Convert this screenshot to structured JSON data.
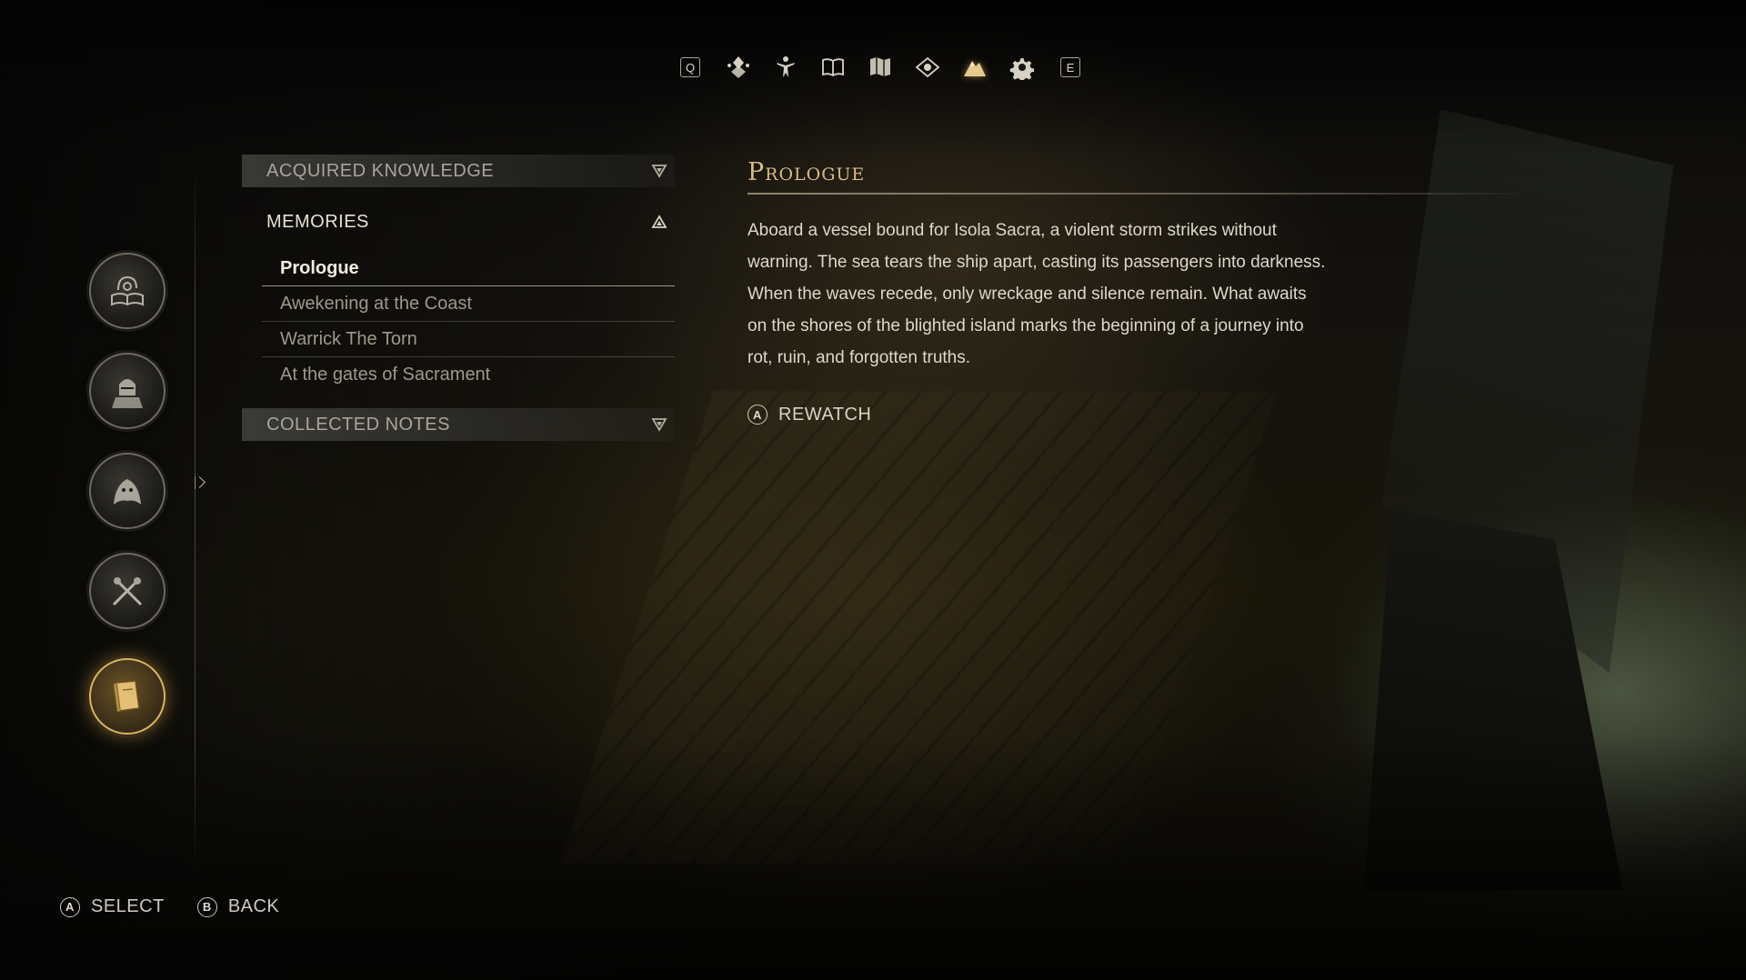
{
  "top_nav": {
    "left_key": "Q",
    "right_key": "E",
    "icons": [
      {
        "name": "emblem-icon",
        "active": false
      },
      {
        "name": "character-icon",
        "active": false
      },
      {
        "name": "journal-book-icon",
        "active": false
      },
      {
        "name": "map-icon",
        "active": false
      },
      {
        "name": "eye-icon",
        "active": false
      },
      {
        "name": "mountain-knowledge-icon",
        "active": true
      },
      {
        "name": "gear-icon",
        "active": false
      }
    ]
  },
  "side_rail": {
    "medallions": [
      {
        "name": "lore-book-medallion",
        "active": false
      },
      {
        "name": "knight-medallion",
        "active": false
      },
      {
        "name": "beasts-medallion",
        "active": false
      },
      {
        "name": "weapons-medallion",
        "active": false
      },
      {
        "name": "tome-medallion",
        "active": true
      }
    ]
  },
  "knowledge": {
    "acquired_label": "ACQUIRED KNOWLEDGE",
    "memories_label": "MEMORIES",
    "collected_label": "COLLECTED NOTES",
    "memories": [
      {
        "label": "Prologue"
      },
      {
        "label": "Awekening at the Coast"
      },
      {
        "label": "Warrick The Torn"
      },
      {
        "label": "At the gates of Sacrament"
      }
    ]
  },
  "detail": {
    "title": "Prologue",
    "body": "Aboard a vessel bound for Isola Sacra, a violent storm strikes without warning. The sea tears the ship apart, casting its passengers into darkness. When the waves recede, only wreckage and silence remain. What awaits on the shores of the blighted island marks the beginning of a journey into rot, ruin, and forgotten truths.",
    "rewatch_button": "A",
    "rewatch_label": "REWATCH"
  },
  "footer": {
    "select_button": "A",
    "select_label": "SELECT",
    "back_button": "B",
    "back_label": "BACK"
  },
  "colors": {
    "accent_gold": "#d7bb88",
    "active_glow": "#d7b46a",
    "text": "#ddd8cb"
  }
}
